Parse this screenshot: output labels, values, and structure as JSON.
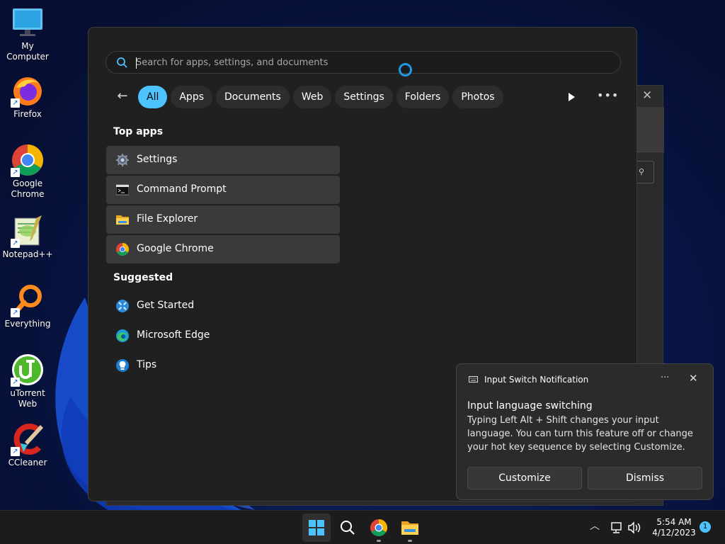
{
  "desktop": {
    "icons": [
      {
        "label": "My Computer"
      },
      {
        "label": "Firefox"
      },
      {
        "label": "Google Chrome"
      },
      {
        "label": "Notepad++"
      },
      {
        "label": "Everything"
      },
      {
        "label": "uTorrent Web"
      },
      {
        "label": "CCleaner"
      }
    ]
  },
  "start": {
    "search": {
      "placeholder": "Search for apps, settings, and documents",
      "value": ""
    },
    "tabs": [
      "All",
      "Apps",
      "Documents",
      "Web",
      "Settings",
      "Folders",
      "Photos"
    ],
    "active_tab": "All",
    "top_apps_heading": "Top apps",
    "top_apps": [
      {
        "label": "Settings",
        "icon": "settings-gear-icon"
      },
      {
        "label": "Command Prompt",
        "icon": "command-prompt-icon"
      },
      {
        "label": "File Explorer",
        "icon": "file-explorer-icon"
      },
      {
        "label": "Google Chrome",
        "icon": "chrome-icon"
      }
    ],
    "suggested_heading": "Suggested",
    "suggested": [
      {
        "label": "Get Started",
        "icon": "get-started-icon"
      },
      {
        "label": "Microsoft Edge",
        "icon": "edge-icon"
      },
      {
        "label": "Tips",
        "icon": "tips-icon"
      }
    ]
  },
  "notification": {
    "app_title": "Input Switch Notification",
    "heading": "Input language switching",
    "body": "Typing Left Alt + Shift changes your input language. You can turn this feature off or change your hot key sequence by selecting Customize.",
    "customize_label": "Customize",
    "dismiss_label": "Dismiss"
  },
  "taskbar": {
    "time": "5:54 AM",
    "date": "4/12/2023",
    "notification_count": "1"
  },
  "colors": {
    "accent": "#4cc2ff",
    "panel_bg": "#202020",
    "taskbar_bg": "#1c1c1c"
  }
}
